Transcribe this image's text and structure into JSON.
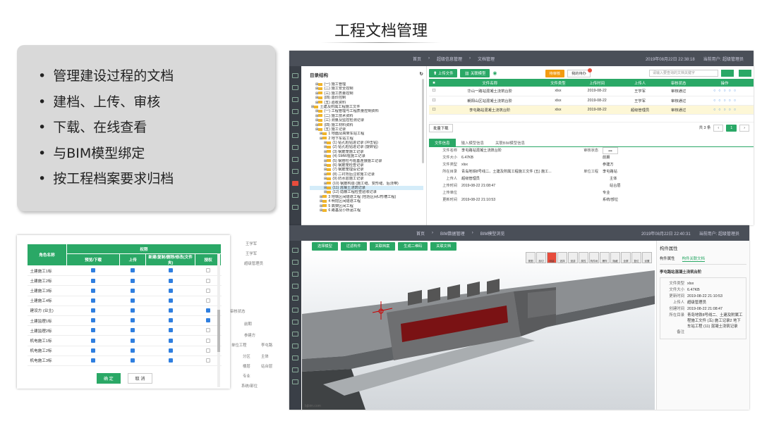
{
  "slide": {
    "title": "工程文档管理",
    "bullets": [
      "管理建设过程的文档",
      "建档、上传、审核",
      "下载、在线查看",
      "与BIM模型绑定",
      "按工程档案要求归档"
    ]
  },
  "doc_app": {
    "breadcrumb": [
      "首页",
      "超级信息管理",
      "文档管理"
    ],
    "datetime": "2019年08月22日 22:38:18",
    "current_user": "当前用户: 超级管理员",
    "tree": {
      "title": "目录结构",
      "nodes": [
        "(一) 施工管理",
        "(二) 施工安全控制",
        "(三) 施工质量控制",
        "(四) 造价控制",
        "(五) 验收资料",
        "土建及附属工程施工文件",
        "(一) 工程管理与工程质量控制资料",
        "(二) 施工技术资料",
        "(三) 测量及监控检测记录",
        "(四) 施工材料资料",
        "(五) 施工记录",
        "1 地面及高架车站工程",
        "2 地下车站工程",
        "(1) 钻孔桩钻进记录 (冲击钻)",
        "(2) 钻孔桩钻进记录 (旋转钻)",
        "(3) 钢筋笼施工记录",
        "(4) SMW桩施工记录",
        "(5) 钢管柱与桩基连接施工记录",
        "(6) 钢筋笼检查记录",
        "(7) 钢筋笼埋设记录",
        "(8) 二衬背后注浆施工记录",
        "(9) 防水层施工记录",
        "(10) 钢筋构造 (施工缝、变形缝、后浇带)",
        "(11) 混凝土浇筑记录",
        "(12) 隐蔽工程检查验收记录",
        "3 地铁区间隧道工程 (包括区间U形槽工程)",
        "4 明挖区间隧道工程",
        "5 高架区间工程",
        "6 路基及小桥涵工程"
      ],
      "selected_index": 23
    },
    "toolbar": {
      "upload": "上传文件",
      "bind": "关联模型",
      "tag_a": "待审核",
      "tag_b": "我的待办",
      "search_placeholder": "请输入要查询的文档关键字"
    },
    "table": {
      "headers": [
        "文件名称",
        "文件类型",
        "上传时间",
        "上传人",
        "审核状态",
        "操作"
      ],
      "rows": [
        [
          "华山一路站混凝土浇筑台阶",
          "xlsx",
          "2019-08-22",
          "王学军",
          "审核通过"
        ],
        [
          "朝阳山区站混凝土浇筑台阶",
          "xlsx",
          "2019-08-22",
          "王学军",
          "审核通过"
        ],
        [
          "李屯路站混凝土浇筑台阶",
          "xlsx",
          "2019-08-22",
          "超级管理员",
          "审核通过"
        ]
      ],
      "selected_row": 2
    },
    "batch_download": "批量下载",
    "page_info": "共 3 条",
    "detail_tabs": [
      "文件信息",
      "输入模型信息",
      "关联BIM模型信息"
    ],
    "detail": [
      [
        "文件名称",
        "李屯路站混凝土浇筑台阶",
        "审核状态",
        "•••"
      ],
      [
        "文件大小",
        "6.47KB",
        "",
        "前期"
      ],
      [
        "文件类型",
        "xlsx",
        "",
        "参建方"
      ],
      [
        "所在目录",
        "青岛地铁8号线二、土建及附属工程施工文件 (五) 施工...",
        "单位工程",
        "李屯路站"
      ],
      [
        "上传人",
        "超级管理员",
        "",
        "分区"
      ],
      [
        "上传时间",
        "2019-08-22 21:08:47",
        "",
        "楼层"
      ],
      [
        "上传单位",
        "",
        "",
        "专业"
      ],
      [
        "更新时间",
        "2019-08-22 21:10:53",
        "",
        "系统/部位"
      ]
    ],
    "detail_extra": [
      "主体",
      "站台层"
    ]
  },
  "permission": {
    "headers": {
      "role": "角色名称",
      "group": "权限",
      "cols": [
        "预览/下载",
        "上传",
        "新建/复制/删除/修改(文件夹)",
        "授权"
      ]
    },
    "rows": [
      {
        "name": "土建施工1标",
        "v": [
          1,
          1,
          1,
          0
        ]
      },
      {
        "name": "土建施工2标",
        "v": [
          1,
          1,
          1,
          0
        ]
      },
      {
        "name": "土建施工3标",
        "v": [
          1,
          1,
          1,
          0
        ]
      },
      {
        "name": "土建施工4标",
        "v": [
          1,
          1,
          1,
          0
        ]
      },
      {
        "name": "建设方 (业主)",
        "v": [
          1,
          1,
          1,
          1
        ]
      },
      {
        "name": "土建监理1标",
        "v": [
          1,
          1,
          1,
          1
        ]
      },
      {
        "name": "土建监理2标",
        "v": [
          1,
          1,
          1,
          0
        ]
      },
      {
        "name": "机电施工1标",
        "v": [
          1,
          1,
          1,
          0
        ]
      },
      {
        "name": "机电施工2标",
        "v": [
          1,
          1,
          1,
          0
        ]
      },
      {
        "name": "机电施工3标",
        "v": [
          1,
          1,
          1,
          0
        ]
      }
    ],
    "ok": "确 定",
    "cancel": "取 消",
    "side_labels": [
      "王学军",
      "王学军",
      "超级管理员",
      "审核状态",
      "前期",
      "参建方",
      "单位工程",
      "李屯路",
      "分区",
      "主体",
      "楼层",
      "站台层",
      "专业",
      "系统/部位"
    ]
  },
  "bim_app": {
    "breadcrumb": [
      "首页",
      "BIM数据管理",
      "BIM模型浏览"
    ],
    "datetime": "2019年08月22日 22:40:31",
    "current_user": "当前用户: 超级管理员",
    "tools": [
      "选择模型",
      "过滤构件",
      "关联档案",
      "生成二维码",
      "关联文档"
    ],
    "view_tools": [
      "视图",
      "剖切",
      "测量",
      "选择",
      "漫游",
      "属性",
      "构件树",
      "爆炸",
      "隐藏",
      "全屏",
      "复位",
      "设置"
    ],
    "props": {
      "title": "构件属性",
      "tabs": [
        "构件属性",
        "构件关联文档"
      ],
      "doc_title": "李屯路站混凝土浇筑台阶",
      "fields": [
        [
          "文件类型",
          "xlsx"
        ],
        [
          "文件大小",
          "6.47KB"
        ],
        [
          "更新时间",
          "2019-08-22 21:10:53"
        ],
        [
          "上传人",
          "超级管理员"
        ],
        [
          "创建时间",
          "2019-08-22 21:08:47"
        ],
        [
          "所在目录",
          "青岛地铁8号线二、土建及附属工程施工文件 (五) 施工记录2 地下车站工程 (11) 混凝土浇筑记录"
        ],
        [
          "备注",
          ""
        ]
      ]
    },
    "watermark": "bjbim.com"
  },
  "colors": {
    "green": "#2aa866",
    "orange": "#f39c12",
    "red": "#e74c3c",
    "dark": "#4a4f58",
    "check": "#2f7fe0"
  }
}
